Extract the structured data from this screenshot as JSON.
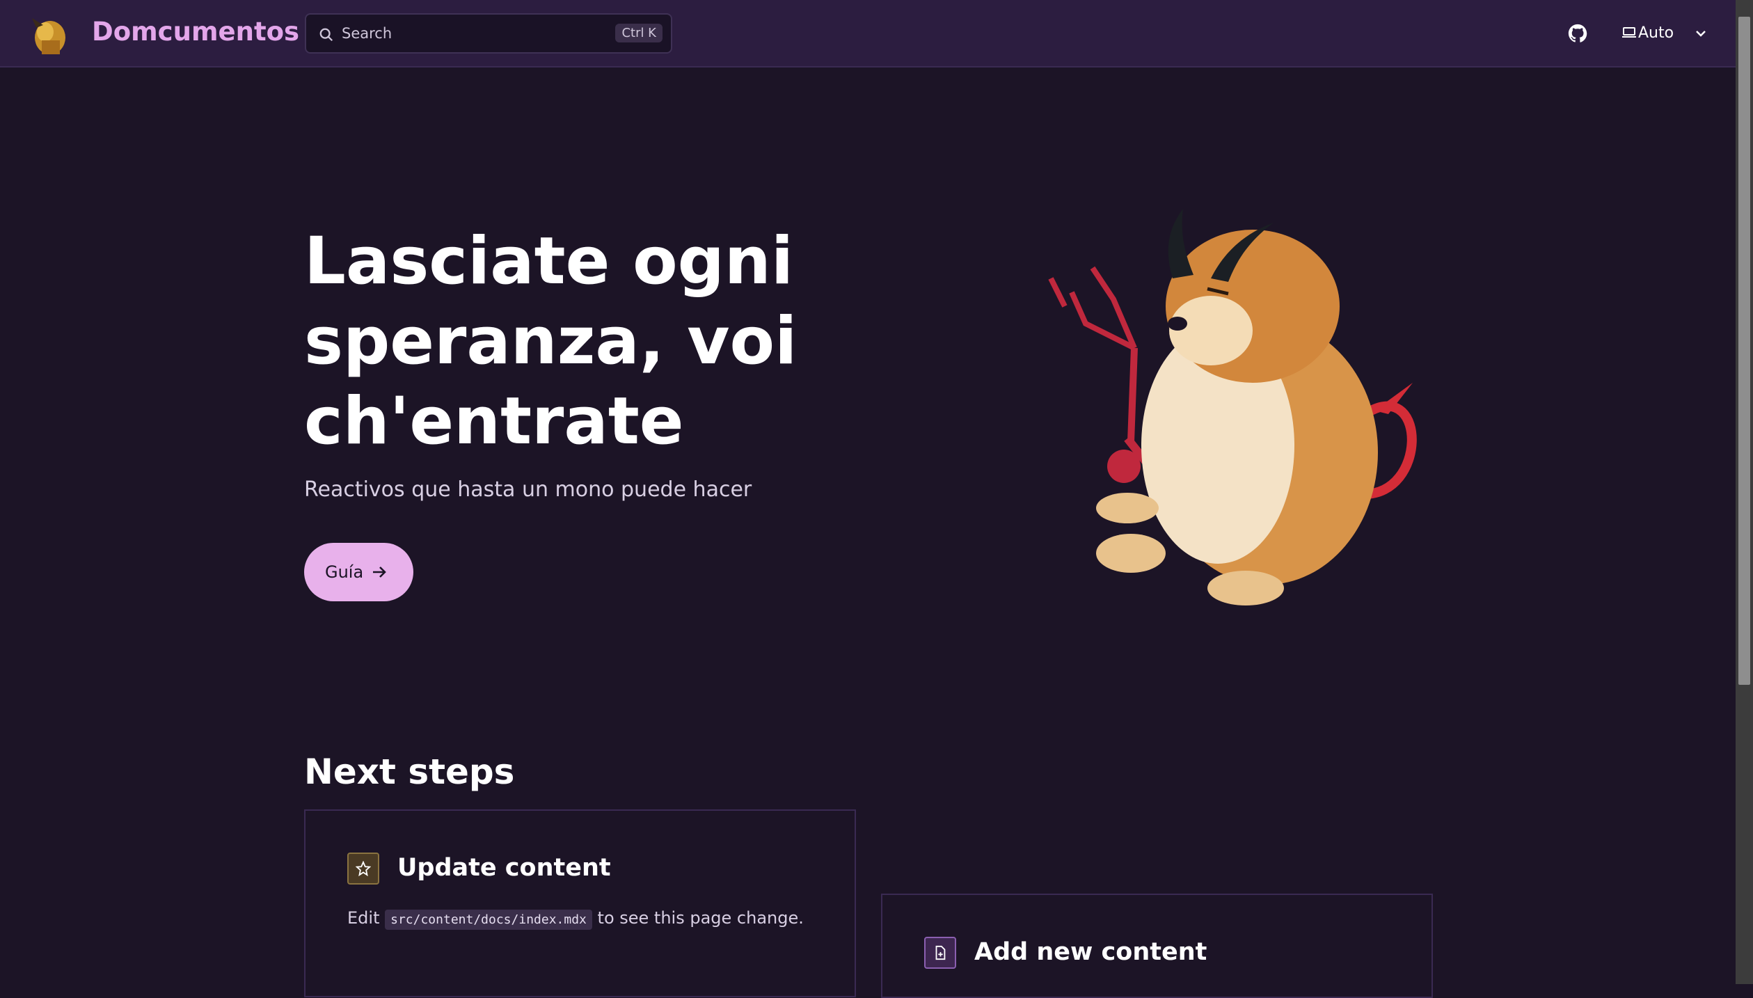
{
  "header": {
    "site_title": "Domcumentos",
    "search": {
      "placeholder": "Search",
      "shortcut": "Ctrl K"
    },
    "theme_select": {
      "value": "Auto"
    },
    "icons": [
      "logo-icon",
      "search-icon",
      "github-icon",
      "laptop-icon",
      "chevron-down-icon"
    ]
  },
  "hero": {
    "title": "Lasciate ogni speranza, voi ch'entrate",
    "tagline": "Reactivos que hasta un mono puede hacer",
    "cta_label": "Guía"
  },
  "next_steps": {
    "heading": "Next steps",
    "cards": [
      {
        "title": "Update content",
        "body_prefix": "Edit",
        "code": "src/content/docs/index.mdx",
        "body_suffix": "to see this page change.",
        "icon": "star-icon"
      },
      {
        "title": "Add new content",
        "icon": "document-add-icon"
      }
    ]
  },
  "colors": {
    "background": "#1c1426",
    "header": "#2c1d40",
    "accent": "#e3a6ea",
    "button": "#e8b1eb"
  }
}
